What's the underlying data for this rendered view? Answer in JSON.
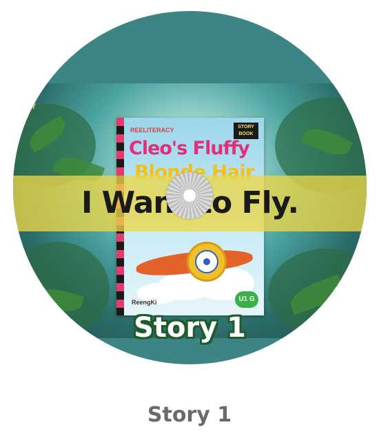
{
  "disc": {
    "background_color": "#3d8585",
    "overlay_title": "I Want to Fly.",
    "label": "Story 1",
    "brand_partial": "CY",
    "book_cover": {
      "brand": "REELITERACY",
      "badge_line1": "STORY",
      "badge_line2": "BOOK",
      "title_line1": "Cleo's Fluffy",
      "title_line2": "Blonde Hair",
      "author": "ReengKi",
      "level_badge": "U1 G"
    }
  },
  "caption": "Story 1"
}
